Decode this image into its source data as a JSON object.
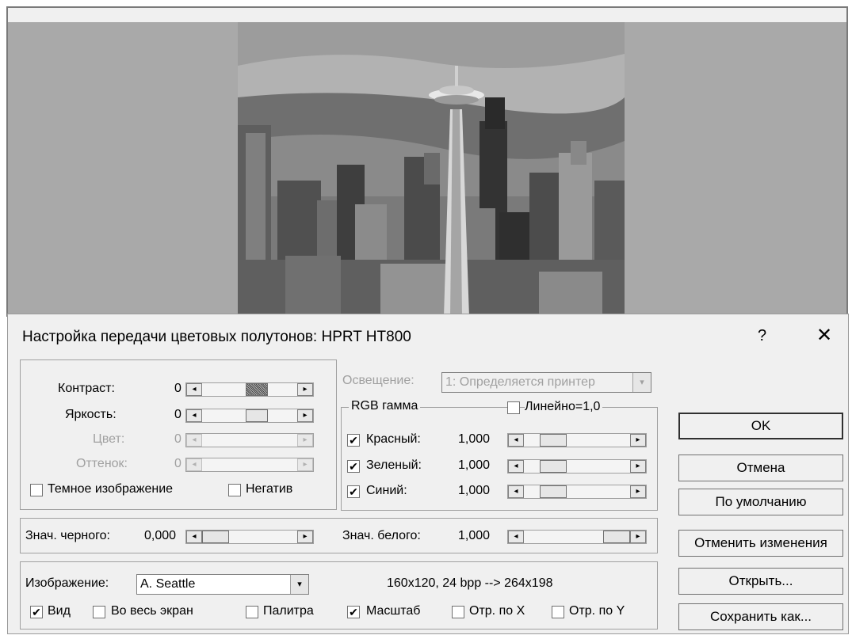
{
  "dialog": {
    "title": "Настройка передачи цветовых полутонов: HPRT HT800",
    "help_label": "?",
    "close_label": "✕"
  },
  "adjust": {
    "contrast": {
      "label": "Контраст:",
      "value": "0"
    },
    "brightness": {
      "label": "Яркость:",
      "value": "0"
    },
    "color": {
      "label": "Цвет:",
      "value": "0"
    },
    "tint": {
      "label": "Оттенок:",
      "value": "0"
    },
    "dark_image": {
      "label": "Темное изображение",
      "checked": false
    },
    "negative": {
      "label": "Негатив",
      "checked": false
    }
  },
  "illumination": {
    "label": "Освещение:",
    "value": "1: Определяется принтер"
  },
  "rgb": {
    "group_label": "RGB гамма",
    "linear": {
      "label": "Линейно=1,0",
      "checked": false
    },
    "red": {
      "label": "Красный:",
      "value": "1,000",
      "checked": true
    },
    "green": {
      "label": "Зеленый:",
      "value": "1,000",
      "checked": true
    },
    "blue": {
      "label": "Синий:",
      "value": "1,000",
      "checked": true
    }
  },
  "levels": {
    "black": {
      "label": "Знач. черного:",
      "value": "0,000"
    },
    "white": {
      "label": "Знач. белого:",
      "value": "1,000"
    }
  },
  "image": {
    "label": "Изображение:",
    "selected": "A. Seattle",
    "info": "160x120, 24 bpp  --> 264x198",
    "view": {
      "label": "Вид",
      "checked": true
    },
    "fullscreen": {
      "label": "Во весь экран",
      "checked": false
    },
    "palette": {
      "label": "Палитра",
      "checked": false
    },
    "scale": {
      "label": "Масштаб",
      "checked": true
    },
    "flip_x": {
      "label": "Отр. по X",
      "checked": false
    },
    "flip_y": {
      "label": "Отр. по Y",
      "checked": false
    }
  },
  "buttons": {
    "ok": "OK",
    "cancel": "Отмена",
    "defaults": "По умолчанию",
    "revert": "Отменить изменения",
    "open": "Открыть...",
    "save_as": "Сохранить как..."
  },
  "icons": {
    "check": "✔",
    "arrow_left": "◂",
    "arrow_right": "▸",
    "dropdown": "▾"
  }
}
